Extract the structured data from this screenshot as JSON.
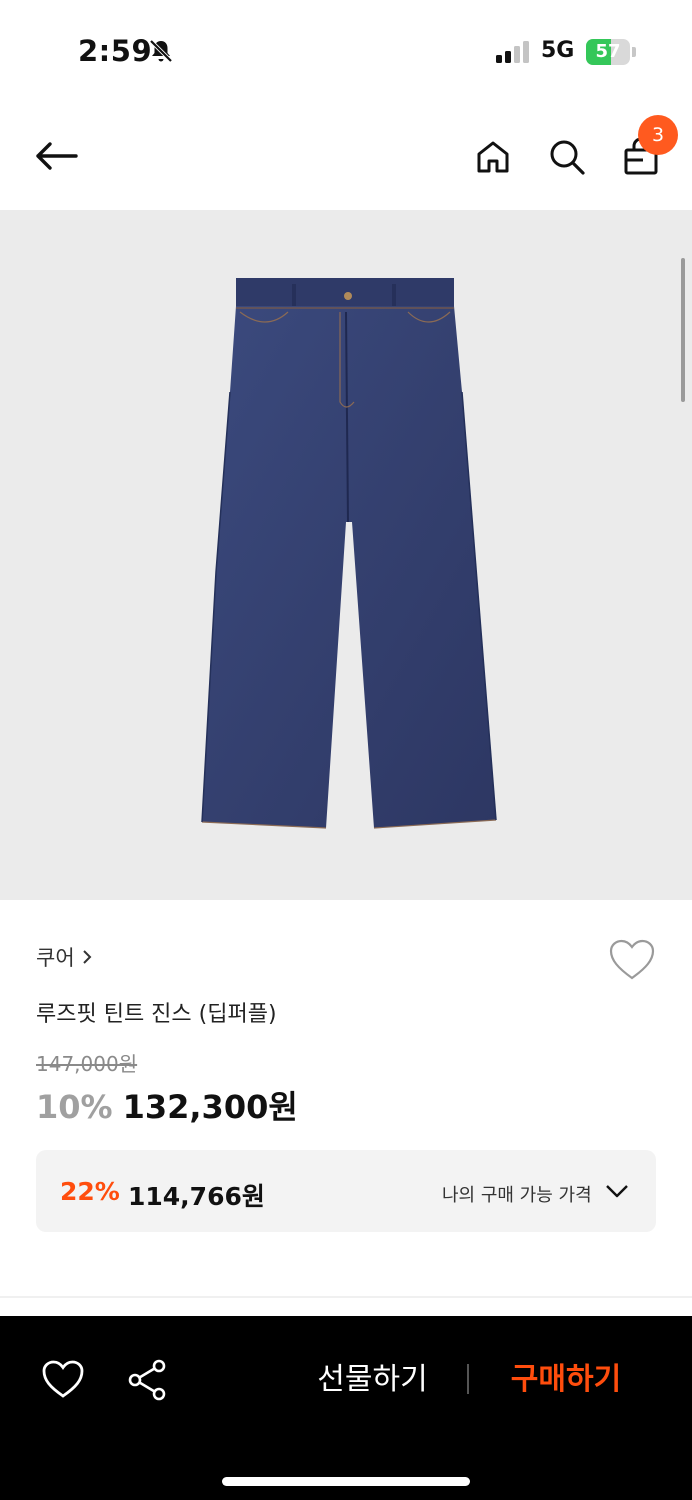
{
  "status_bar": {
    "time": "2:59",
    "network": "5G",
    "battery": "57",
    "battery_level": 0.57
  },
  "nav": {
    "cart_count": "3"
  },
  "product": {
    "brand": "쿠어",
    "name": "루즈핏 틴트 진스 (딥퍼플)",
    "original_price": "147,000원",
    "discount_rate": "10%",
    "sale_price": "132,300원"
  },
  "my_price": {
    "rate": "22%",
    "price": "114,766원",
    "label": "나의 구매 가능 가격"
  },
  "bottom_bar": {
    "gift_label": "선물하기",
    "buy_label": "구매하기"
  },
  "colors": {
    "accent": "#ff4d0d",
    "badge": "#ff5a1f",
    "battery": "#34c759"
  }
}
